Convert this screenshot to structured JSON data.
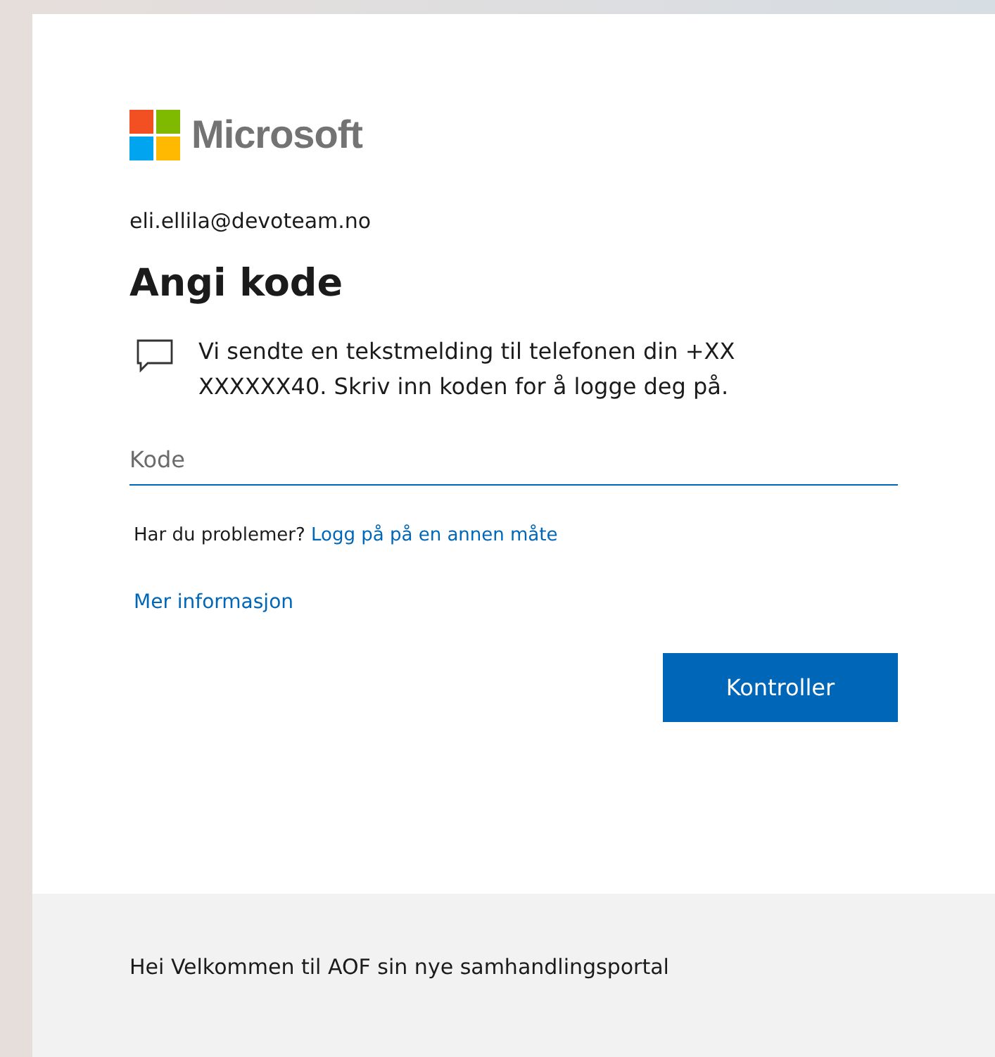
{
  "logo": {
    "text": "Microsoft"
  },
  "account": "eli.ellila@devoteam.no",
  "title": "Angi kode",
  "message": "Vi sendte en tekstmelding til telefonen din +XX XXXXXX40. Skriv inn koden for å logge deg på.",
  "code_field": {
    "placeholder": "Kode"
  },
  "help": {
    "text": "Har du problemer?",
    "link": "Logg på på en annen måte"
  },
  "more_info_link": "Mer informasjon",
  "buttons": [
    "Kontroller"
  ],
  "footer": "Hei Velkommen til AOF sin nye samhandlingsportal"
}
